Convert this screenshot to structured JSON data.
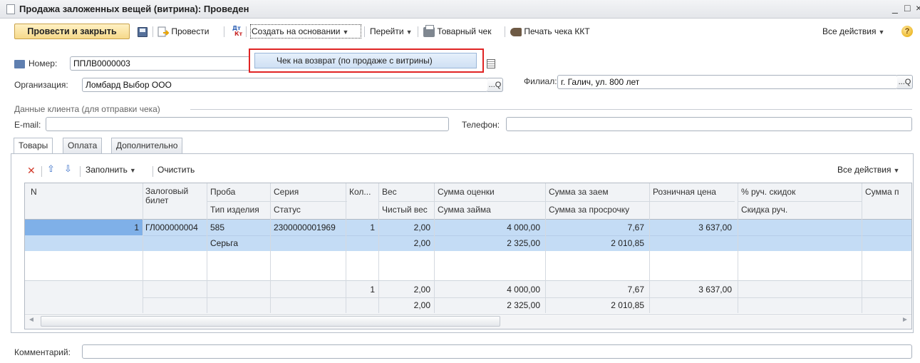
{
  "window": {
    "title": "Продажа заложенных вещей (витрина): Проведен"
  },
  "toolbar": {
    "post_and_close": "Провести и закрыть",
    "post": "Провести",
    "create_based_on": "Создать на основании",
    "go_to": "Перейти",
    "sales_receipt": "Товарный чек",
    "print_kkt": "Печать чека ККТ",
    "all_actions": "Все действия",
    "help": "?"
  },
  "popup": {
    "item": "Чек на возврат (по продаже с витрины)"
  },
  "form": {
    "number_label": "Номер:",
    "number_value": "ППЛВ0000003",
    "org_label": "Организация:",
    "org_value": "Ломбард Выбор ООО",
    "branch_label": "Филиал:",
    "branch_value": "г. Галич, ул. 800 лет",
    "client_group": "Данные клиента (для отправки чека)",
    "email_label": "E-mail:",
    "email_value": "",
    "phone_label": "Телефон:",
    "phone_value": "",
    "comment_label": "Комментарий:",
    "comment_value": "",
    "lookup_btn": "...",
    "search_btn": "Q"
  },
  "tabs": [
    "Товары",
    "Оплата",
    "Дополнительно"
  ],
  "grid_toolbar": {
    "fill": "Заполнить",
    "clear": "Очистить",
    "all_actions": "Все действия"
  },
  "grid": {
    "header_row1": [
      "N",
      "Залоговый билет",
      "Проба",
      "Серия",
      "Кол...",
      "Вес",
      "Сумма оценки",
      "Сумма за заем",
      "Розничная цена",
      "% руч. скидок",
      "Сумма п"
    ],
    "header_row2": [
      "",
      "",
      "Тип изделия",
      "Статус",
      "",
      "Чистый вес",
      "Сумма займа",
      "Сумма за просрочку",
      "",
      "Скидка руч.",
      ""
    ],
    "row1_line1": [
      "1",
      "ГЛ000000004",
      "585",
      "2300000001969",
      "1",
      "2,00",
      "4 000,00",
      "7,67",
      "3 637,00",
      "",
      ""
    ],
    "row1_line2": [
      "",
      "",
      "Серьга",
      "",
      "",
      "2,00",
      "2 325,00",
      "2 010,85",
      "",
      "",
      ""
    ],
    "total_line1": [
      "",
      "",
      "",
      "",
      "1",
      "2,00",
      "4 000,00",
      "7,67",
      "3 637,00",
      "",
      ""
    ],
    "total_line2": [
      "",
      "",
      "",
      "",
      "",
      "2,00",
      "2 325,00",
      "2 010,85",
      "",
      "",
      ""
    ]
  },
  "colors": {
    "selected_row": "#c4dcf5",
    "primary_button": "#f6d98a",
    "popup_border": "#e02424",
    "header": "#f1f3f6"
  }
}
